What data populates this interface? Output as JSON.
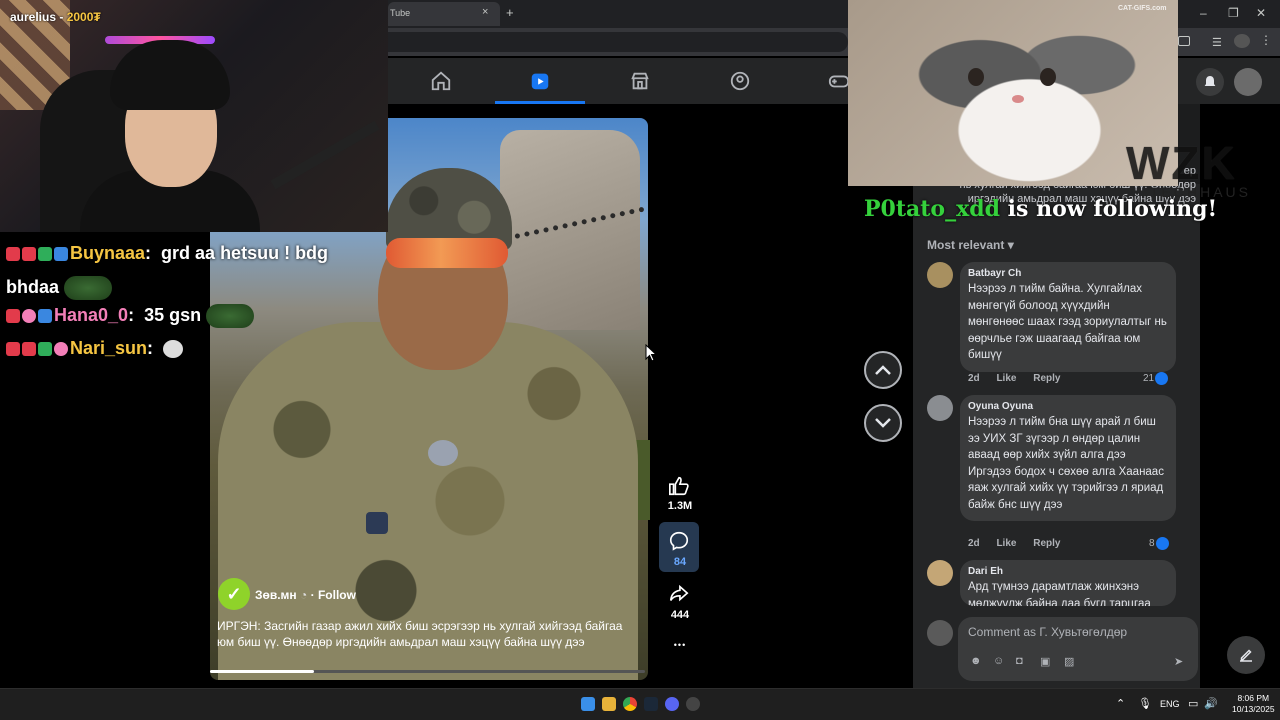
{
  "stream": {
    "streamer": "aurelius",
    "points": "2000₮"
  },
  "browser": {
    "tab_title": "Tube",
    "tab_close": "×",
    "new_tab": "+",
    "window_controls": [
      "–",
      "❐",
      "✕"
    ]
  },
  "fb_nav": {
    "items": [
      {
        "icon": "home-icon",
        "active": false
      },
      {
        "icon": "reels-icon",
        "active": true
      },
      {
        "icon": "marketplace-icon",
        "active": false
      },
      {
        "icon": "groups-icon",
        "active": false
      },
      {
        "icon": "gaming-icon",
        "active": false
      }
    ],
    "active_color": "#1877f2"
  },
  "reel": {
    "author": "Зөв.мн",
    "follow_label": "· Follow",
    "caption": "ИРГЭН: Засгийн газар ажил хийх биш эсрэгээр нь хулгай хийгээд байгаа юм биш үү. Өнөөдөр иргэдийн амьдрал маш хэцүү байна шүү дээ",
    "likes": "1.3M",
    "comments": "84",
    "shares": "444",
    "more": "•••",
    "progress": 0.24
  },
  "chat": [
    {
      "user": "Buynaaa",
      "color": "#f5c542",
      "message": "grd aa hetsuu ! bdg bhdaa"
    },
    {
      "user": "Hana0_0",
      "color": "#f37fb8",
      "message": "35 gsn"
    },
    {
      "user": "Nari_sun",
      "color": "#f5c542",
      "message": ""
    }
  ],
  "alert": {
    "follower": "P0tato_xdd",
    "text": "is now following!"
  },
  "logo": {
    "main": "WZK",
    "sub": "TECHHAUS"
  },
  "catgif_watermark": "CAT-GIFS.com",
  "ghost_caption": "ер\nнь хулгай хийгээд байгаа юм биш үү. Өнөөдөр\nиргэдийн амьдрал маш хэцүү байна шүү дээ",
  "comments": {
    "sort_label": "Most relevant",
    "items": [
      {
        "name": "Batbayr Ch",
        "text": "Нээрээ л тийм байна. Хулгайлах мөнгөгүй болоод хүүхдийн мөнгөнөөс шаах гээд зориулалтыг нь өөрчлье гэж шаагаад байгаа юм бишүү",
        "time": "2d",
        "like": "Like",
        "reply": "Reply",
        "likes": "21"
      },
      {
        "name": "Oyuna Oyuna",
        "text": "Нээрээ л тийм бна шүү арай л биш ээ УИХ ЗГ зүгээр л өндөр цалин аваад өөр хийх зүйл алга дээ Иргэдээ бодох ч сөхөө алга Хаанаас яаж хулгай хийх үү тэрийгээ л яриад байж бнс шүү дээ",
        "time": "2d",
        "like": "Like",
        "reply": "Reply",
        "likes": "8"
      },
      {
        "name": "Dari Eh",
        "text": "Ард түмнээ дарамтлаж жинхэнэ мөлжүүлж байна даа бүгд тарцгаа",
        "time": "",
        "like": "",
        "reply": "",
        "likes": ""
      }
    ],
    "composer_placeholder": "Comment as Г. Хувьтөгөлдөр"
  },
  "taskbar": {
    "lang": "ENG",
    "time": "8:06 PM",
    "date": "10/13/2025"
  }
}
